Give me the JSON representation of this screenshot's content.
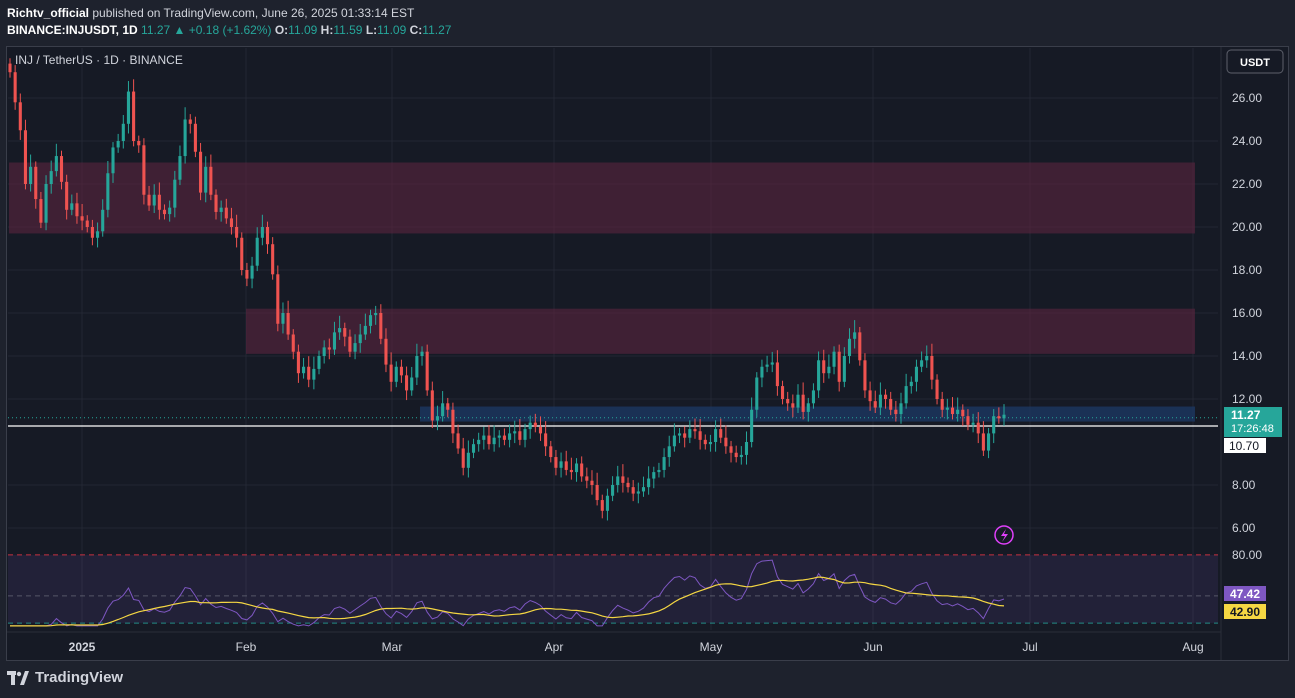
{
  "header": {
    "author": "Richtv_official",
    "published_text": "published on TradingView.com, June 26, 2025 01:33:14 EST",
    "symbol_line": "BINANCE:INJUSDT, 1D",
    "last": "11.27",
    "change": "+0.18 (+1.62%)",
    "o_label": "O:",
    "o": "11.09",
    "h_label": "H:",
    "h": "11.59",
    "l_label": "L:",
    "l": "11.09",
    "c_label": "C:",
    "c": "11.27"
  },
  "footer": {
    "brand": "TradingView"
  },
  "chart_data": {
    "type": "candlestick",
    "title": "INJ / TetherUS · 1D · BINANCE",
    "currency": "USDT",
    "ylim": [
      5.0,
      28.0
    ],
    "yticks": [
      "26.00",
      "24.00",
      "22.00",
      "20.00",
      "18.00",
      "16.00",
      "14.00",
      "12.00",
      "8.00",
      "6.00"
    ],
    "xticks": [
      "2025",
      "Feb",
      "Mar",
      "Apr",
      "May",
      "Jun",
      "Jul",
      "Aug"
    ],
    "price_label": "11.27",
    "countdown_label": "17:26:48",
    "level_label": "10.70",
    "horizontal_line": 10.7,
    "zones": [
      {
        "from": 19.7,
        "to": 23.0,
        "color": "#5b2440"
      },
      {
        "from": 14.1,
        "to": 16.2,
        "color": "#5b2440"
      },
      {
        "from": 10.95,
        "to": 11.65,
        "color": "#1c3a66"
      }
    ],
    "colors": {
      "up": "#26a69a",
      "down": "#ef5350",
      "rsi": "#7e57c2",
      "rsi_ma": "#f5d743"
    },
    "closes": [
      27.2,
      25.8,
      24.5,
      22.0,
      22.8,
      21.3,
      20.2,
      22.0,
      22.6,
      23.3,
      22.1,
      20.8,
      21.1,
      20.5,
      20.3,
      20.0,
      19.5,
      19.8,
      20.8,
      22.5,
      23.7,
      24.0,
      24.8,
      26.3,
      24.0,
      23.8,
      21.5,
      21.0,
      21.5,
      20.8,
      20.6,
      20.9,
      22.2,
      23.3,
      25.0,
      24.8,
      23.5,
      21.6,
      22.8,
      21.5,
      20.7,
      20.9,
      20.4,
      20.0,
      19.5,
      18.0,
      17.6,
      18.2,
      19.5,
      20.0,
      19.2,
      17.8,
      15.5,
      16.0,
      15.0,
      14.2,
      13.2,
      13.5,
      12.9,
      13.4,
      14.0,
      14.4,
      14.3,
      15.1,
      15.3,
      14.9,
      14.2,
      14.6,
      15.0,
      15.4,
      15.9,
      16.0,
      14.8,
      13.6,
      12.8,
      13.5,
      13.1,
      12.4,
      13.0,
      14.0,
      14.2,
      12.4,
      11.0,
      11.2,
      11.8,
      11.5,
      10.4,
      9.7,
      8.8,
      9.5,
      9.9,
      10.1,
      10.3,
      9.9,
      10.2,
      10.3,
      10.1,
      10.4,
      10.5,
      10.1,
      10.6,
      10.9,
      10.7,
      10.4,
      9.8,
      9.3,
      8.8,
      9.1,
      8.7,
      8.6,
      9.0,
      8.4,
      8.2,
      8.0,
      7.3,
      6.8,
      7.5,
      8.0,
      8.4,
      8.1,
      7.9,
      7.6,
      7.7,
      7.9,
      8.3,
      8.6,
      8.7,
      9.3,
      9.8,
      10.3,
      10.4,
      10.2,
      10.6,
      10.5,
      10.1,
      9.9,
      10.0,
      10.6,
      10.2,
      9.8,
      9.5,
      9.3,
      9.4,
      10.0,
      11.5,
      13.0,
      13.5,
      13.6,
      13.7,
      12.6,
      12.0,
      11.8,
      11.6,
      12.2,
      11.4,
      11.8,
      12.4,
      13.8,
      13.2,
      13.5,
      14.2,
      12.8,
      14.0,
      14.8,
      15.1,
      13.8,
      12.4,
      11.9,
      11.6,
      12.2,
      12.0,
      11.5,
      11.3,
      11.8,
      12.6,
      12.8,
      13.5,
      13.8,
      14.0,
      12.9,
      12.0,
      11.5,
      11.6,
      11.3,
      11.5,
      11.2,
      10.8,
      10.9,
      10.4,
      9.6,
      10.4,
      11.2,
      11.1,
      11.27
    ],
    "rsi": {
      "upper": "80.00",
      "mid_label": "47.42",
      "ma_label": "42.90",
      "bands": [
        30,
        50,
        80
      ],
      "ylim": [
        25,
        85
      ]
    }
  }
}
